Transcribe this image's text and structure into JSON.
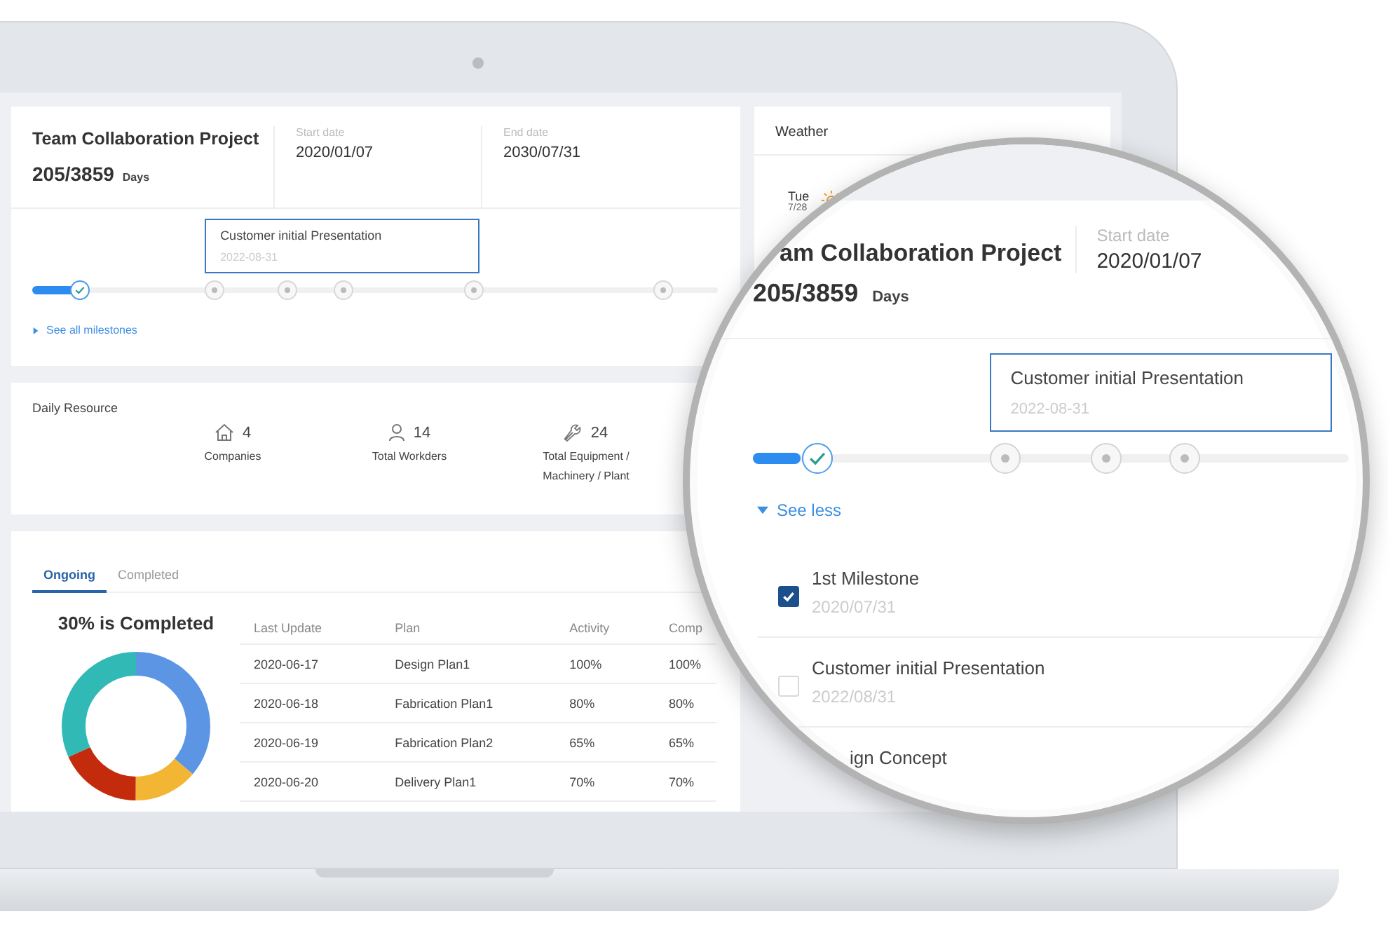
{
  "project": {
    "title": "Team Collaboration Project",
    "progress": "205/3859",
    "progress_unit": "Days",
    "start_label": "Start date",
    "start_date": "2020/01/07",
    "end_label": "End date",
    "end_date": "2030/07/31"
  },
  "timeline": {
    "level": 0.07,
    "toggle": "See all milestones",
    "expanded": false,
    "milestones": [
      {
        "done": true
      },
      {
        "done": false,
        "tooltip": {
          "title": "Customer initial Presentation",
          "date": "2022-08-31"
        }
      },
      {
        "done": false
      },
      {
        "done": false
      },
      {
        "done": false
      },
      {
        "done": false
      }
    ]
  },
  "daily_resource": {
    "title": "Daily Resource",
    "items": [
      {
        "kind": "house",
        "value": "4",
        "label": "Companies"
      },
      {
        "kind": "person",
        "value": "14",
        "label": "Total Workders"
      },
      {
        "kind": "wrench",
        "value": "24",
        "label": "Total Equipment / Machinery / Plant"
      }
    ]
  },
  "plans": {
    "tabs": [
      {
        "label": "Ongoing",
        "selected": true
      },
      {
        "label": "Completed",
        "selected": false
      }
    ],
    "summary": "30% is Completed",
    "table": {
      "columns": [
        "Last Update",
        "Plan",
        "Activity",
        "Comp"
      ],
      "rows": [
        [
          "2020-06-17",
          "Design Plan1",
          "100%",
          "100%"
        ],
        [
          "2020-06-18",
          "Fabrication Plan1",
          "80%",
          "80%"
        ],
        [
          "2020-06-19",
          "Fabrication Plan2",
          "65%",
          "65%"
        ],
        [
          "2020-06-20",
          "Delivery Plan1",
          "70%",
          "70%"
        ]
      ]
    }
  },
  "weather": {
    "title": "Weather",
    "day": "Tue",
    "date": "7/28"
  },
  "magnifier": {
    "title": "am Collaboration Project",
    "progress": "205/3859",
    "progress_unit": "Days",
    "start_label": "Start date",
    "start_date": "2020/01/07",
    "level": 0.08,
    "toggle": "See less",
    "expanded": true,
    "milestones": [
      {
        "done": true
      },
      {
        "done": false,
        "tooltip": {
          "title": "Customer initial Presentation",
          "date": "2022-08-31"
        }
      },
      {
        "done": false
      },
      {
        "done": false
      }
    ],
    "list": [
      {
        "name": "1st Milestone",
        "date": "2020/07/31",
        "checked": true
      },
      {
        "name": "Customer initial Presentation",
        "date": "2022/08/31",
        "checked": false
      }
    ],
    "partial_item": "ign Concept"
  }
}
